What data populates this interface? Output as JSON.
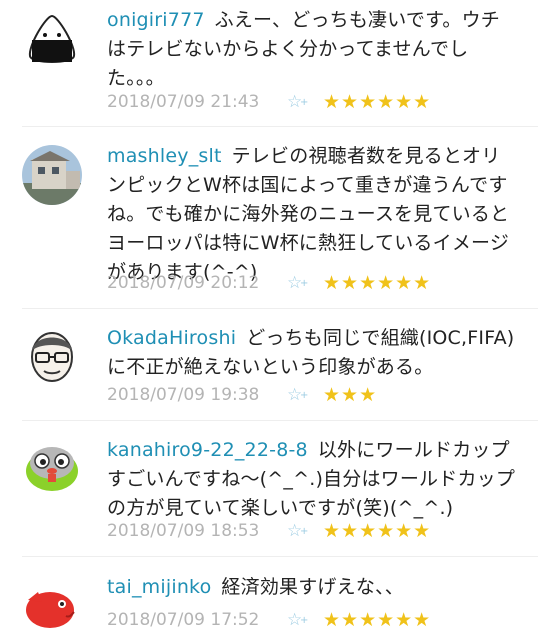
{
  "comments": [
    {
      "user": "onigiri777",
      "text": "ふえー、どっちも凄いです。ウチはテレビないからよく分かってませんでした。。。",
      "date": "2018/07/09 21:43",
      "stars": "★★★★★★",
      "avatar": "onigiri-avatar"
    },
    {
      "user": "mashley_slt",
      "text": "テレビの視聴者数を見るとオリンピックとW杯は国によって重きが違うんですね。でも確かに海外発のニュースを見ているとヨーロッパは特にW杯に熱狂しているイメージがあります(^-^)",
      "date": "2018/07/09 20:12",
      "stars": "★★★★★★",
      "avatar": "house-photo-avatar"
    },
    {
      "user": "OkadaHiroshi",
      "text": "どっちも同じで組織(IOC,FIFA)に不正が絶えないという印象がある。",
      "date": "2018/07/09 19:38",
      "stars": "★★★",
      "avatar": "glasses-man-avatar"
    },
    {
      "user": "kanahiro9-22_22-8-8",
      "text": "以外にワールドカップすごいんですね〜(^_^.)自分はワールドカップの方が見ていて楽しいですが(笑)(^_^.)",
      "date": "2018/07/09 18:53",
      "stars": "★★★★★★",
      "avatar": "green-character-avatar"
    },
    {
      "user": "tai_mijinko",
      "text": "経済効果すげえな、、",
      "date": "2018/07/09 17:52",
      "stars": "★★★★★★",
      "avatar": "red-fish-avatar"
    }
  ],
  "fav_icon": "star-plus-icon",
  "colors": {
    "username": "#1f8fb4",
    "star": "#f0c21a",
    "date": "#b4b4b4"
  }
}
